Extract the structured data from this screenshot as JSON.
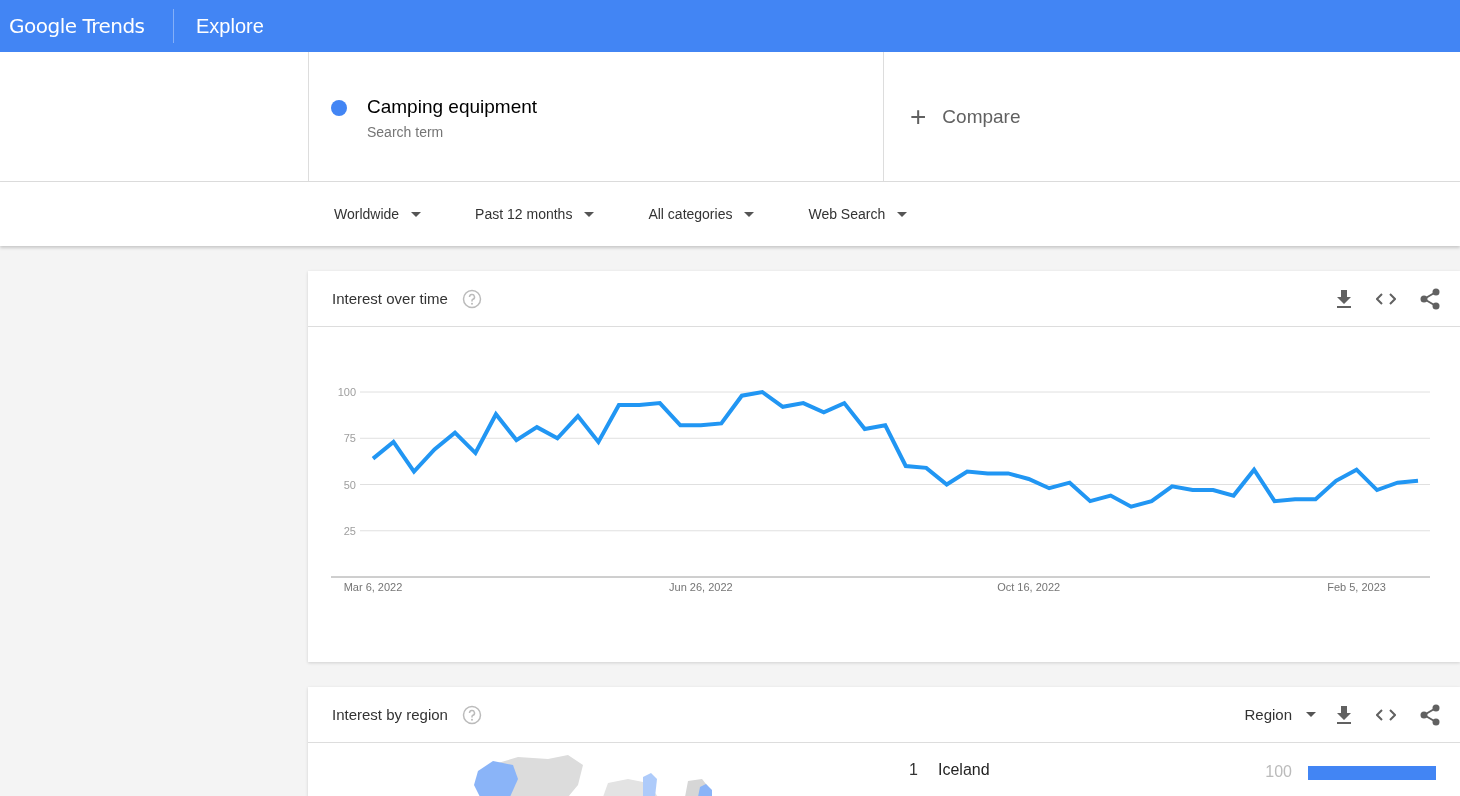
{
  "header": {
    "logo": "Google Trends",
    "title": "Explore"
  },
  "search_term": {
    "name": "Camping equipment",
    "subtitle": "Search term",
    "color": "#4285f4"
  },
  "compare": {
    "icon": "+",
    "label": "Compare"
  },
  "filters": [
    {
      "label": "Worldwide"
    },
    {
      "label": "Past 12 months"
    },
    {
      "label": "All categories"
    },
    {
      "label": "Web Search"
    }
  ],
  "interest_over_time": {
    "title": "Interest over time",
    "chart_data": {
      "type": "line",
      "categories": [
        "Mar 6, 2022",
        null,
        null,
        null,
        null,
        null,
        null,
        null,
        null,
        null,
        null,
        null,
        null,
        null,
        null,
        null,
        "Jun 26, 2022",
        null,
        null,
        null,
        null,
        null,
        null,
        null,
        null,
        null,
        null,
        null,
        null,
        null,
        null,
        null,
        "Oct 16, 2022",
        null,
        null,
        null,
        null,
        null,
        null,
        null,
        null,
        null,
        null,
        null,
        null,
        null,
        null,
        null,
        "Feb 5, 2023",
        null,
        null,
        null
      ],
      "series": [
        {
          "color": "#2196f3",
          "values": [
            64,
            73,
            57,
            69,
            78,
            67,
            88,
            74,
            81,
            75,
            87,
            73,
            93,
            93,
            94,
            82,
            82,
            83,
            98,
            100,
            92,
            94,
            89,
            94,
            80,
            82,
            60,
            59,
            50,
            57,
            56,
            56,
            53,
            48,
            51,
            41,
            44,
            38,
            41,
            49,
            47,
            47,
            44,
            58,
            41,
            42,
            42,
            52,
            58,
            47,
            51,
            52
          ]
        }
      ],
      "ylim": [
        0,
        100
      ],
      "yticks": [
        25,
        50,
        75,
        100
      ],
      "grid": true
    }
  },
  "interest_by_region": {
    "title": "Interest by region",
    "resolution": "Region",
    "rows": [
      {
        "rank": "1",
        "name": "Iceland",
        "value": "100",
        "level": 1.0
      }
    ]
  }
}
